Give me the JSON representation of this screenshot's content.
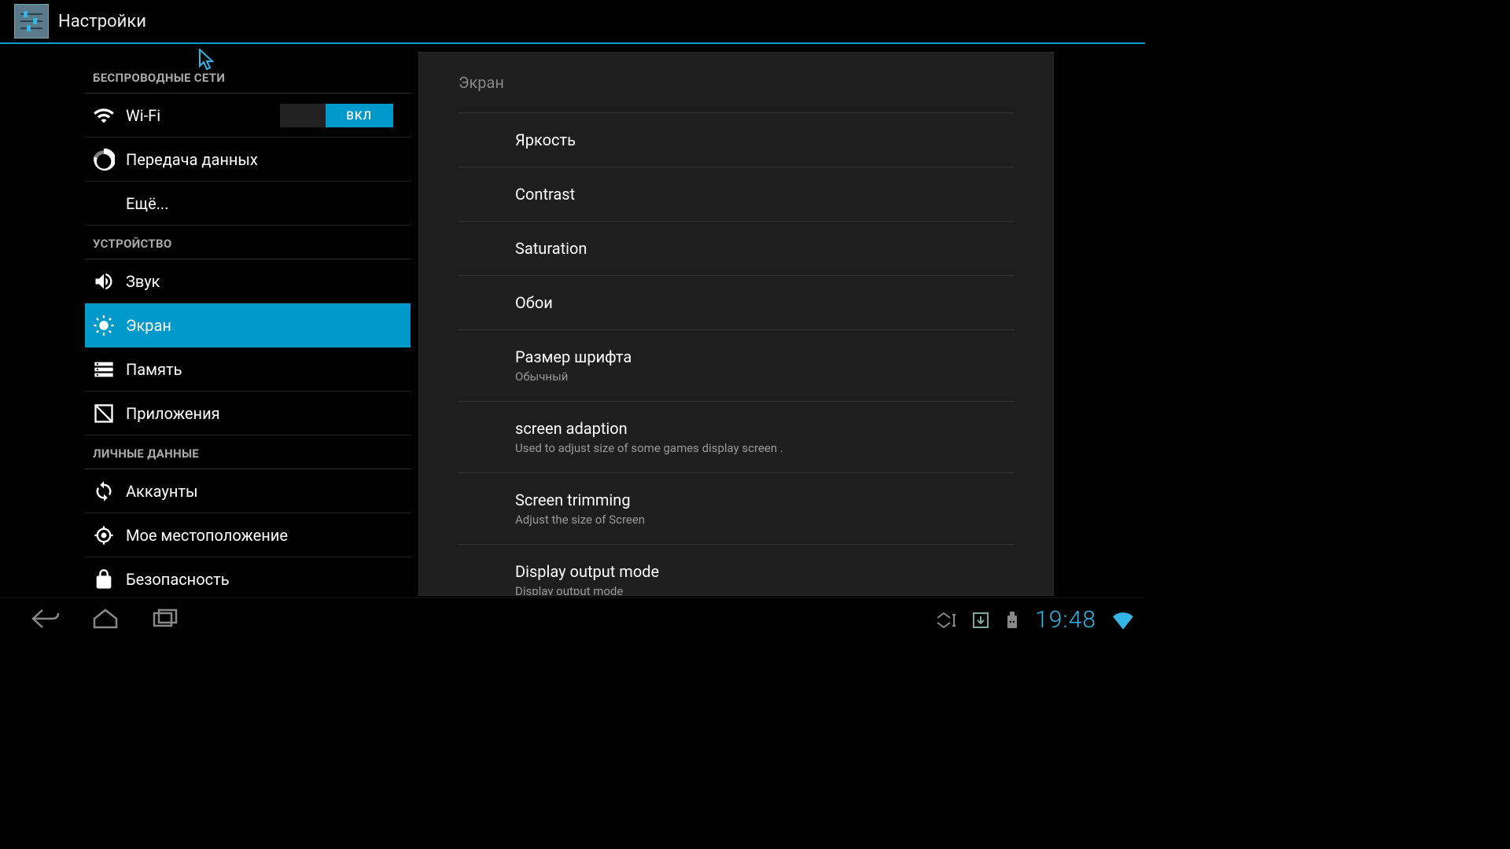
{
  "header": {
    "title": "Настройки"
  },
  "sidebar": {
    "sections": [
      {
        "header": "БЕСПРОВОДНЫЕ СЕТИ",
        "items": [
          {
            "icon": "wifi",
            "label": "Wi-Fi",
            "toggle": "ВКЛ"
          },
          {
            "icon": "data-usage",
            "label": "Передача данных"
          },
          {
            "icon": "blank",
            "label": "Ещё..."
          }
        ]
      },
      {
        "header": "УСТРОЙСТВО",
        "items": [
          {
            "icon": "sound",
            "label": "Звук"
          },
          {
            "icon": "display",
            "label": "Экран",
            "selected": true
          },
          {
            "icon": "storage",
            "label": "Память"
          },
          {
            "icon": "apps",
            "label": "Приложения"
          }
        ]
      },
      {
        "header": "ЛИЧНЫЕ ДАННЫЕ",
        "items": [
          {
            "icon": "sync",
            "label": "Аккаунты"
          },
          {
            "icon": "location",
            "label": "Мое местоположение"
          },
          {
            "icon": "lock",
            "label": "Безопасность"
          }
        ]
      }
    ]
  },
  "detail": {
    "title": "Экран",
    "items": [
      {
        "title": "Яркость"
      },
      {
        "title": "Contrast"
      },
      {
        "title": "Saturation"
      },
      {
        "title": "Обои"
      },
      {
        "title": "Размер шрифта",
        "sub": "Обычный"
      },
      {
        "title": "screen adaption",
        "sub": "Used to adjust size of some games display screen ."
      },
      {
        "title": "Screen trimming",
        "sub": "Adjust the size of Screen"
      },
      {
        "title": "Display output mode",
        "sub": "Display output mode"
      }
    ]
  },
  "statusbar": {
    "clock": "19:48"
  }
}
